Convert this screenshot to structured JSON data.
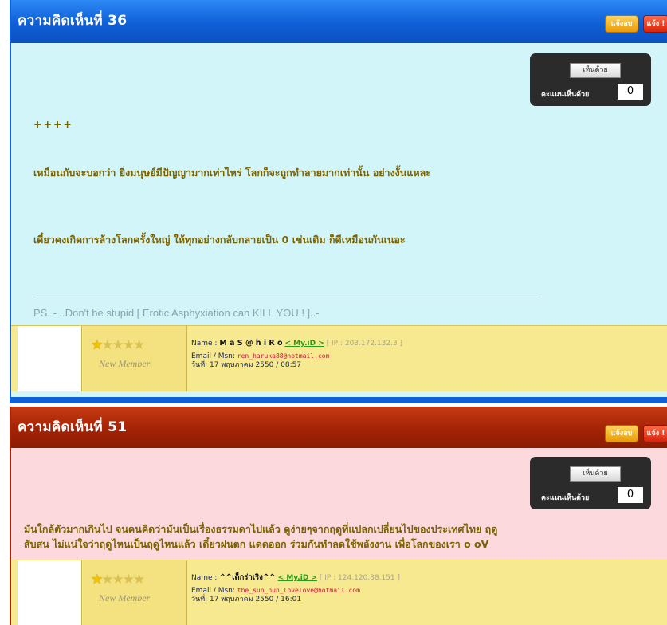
{
  "comments": [
    {
      "header": "ความคิดเห็นที่ 36",
      "edit_label": "แจ้งลบ",
      "report_label": "แจ้ง !",
      "vote": {
        "button": "เห็นด้วย",
        "label": "คะแนนเห็นด้วย",
        "score": "0"
      },
      "body": [
        "++++",
        "เหมือนกับจะบอกว่า ยิ่งมนุษย์มีปัญญามากเท่าไหร่ โลกก็จะถูกทำลายมากเท่านั้น อย่างงั้นแหละ",
        "เดี๋ยวคงเกิดการล้างโลกครั้งใหญ่ ให้ทุกอย่างกลับกลายเป็น 0 เช่นเดิม ก็ดีเหมือนกันเนอะ"
      ],
      "signature": "PS. - ..Don't be stupid [ Erotic Asphyxiation can KILL YOU ! ]..-",
      "rank": "New Member",
      "author": {
        "name_label": "Name :",
        "name": "M a S @ h i R o",
        "myid": "< My.iD >",
        "ip": "[ IP : 203.172.132.3 ]",
        "email_label": "Email / Msn:",
        "email": "ren_haruka88@hotmail.com",
        "date": "วันที่: 17 พฤษภาคม 2550 / 08:57"
      }
    },
    {
      "header": "ความคิดเห็นที่ 51",
      "edit_label": "แจ้งลบ",
      "report_label": "แจ้ง !",
      "vote": {
        "button": "เห็นด้วย",
        "label": "คะแนนเห็นด้วย",
        "score": "0"
      },
      "body": [
        "มันใกล้ตัวมากเกินไป จนคนคิดว่ามันเป็นเรื่องธรรมดาไปแล้ว ดูง่ายๆจากฤดูที่แปลกเปลี่ยนไปของประเทศไทย ฤดู",
        "สับสน ไม่แน่ใจว่าฤดูไหนเป็นฤดูไหนแล้ว เดี๋ยวฝนตก แดดออก ร่วมกันทำลดใช้พลังงาน เพื่อโลกของเรา o oV"
      ],
      "rank": "New Member",
      "author": {
        "name_label": "Name :",
        "name": "^^เด็กร่าเริง^^",
        "myid": "< My.iD >",
        "ip": "[ IP : 124.120.88.151 ]",
        "email_label": "Email / Msn:",
        "email": "the_sun_nun_lovelove@hotmail.com",
        "date": "วันที่: 17 พฤษภาคม 2550 / 16:01"
      }
    }
  ],
  "colors": {
    "blue_header": "#0f5fd6",
    "red_header": "#a32306",
    "card1_bg": "#d1f5f9",
    "card2_bg": "#fbd9dd",
    "footer_bg": "#f7e98f",
    "body_text": "#7a6200"
  }
}
